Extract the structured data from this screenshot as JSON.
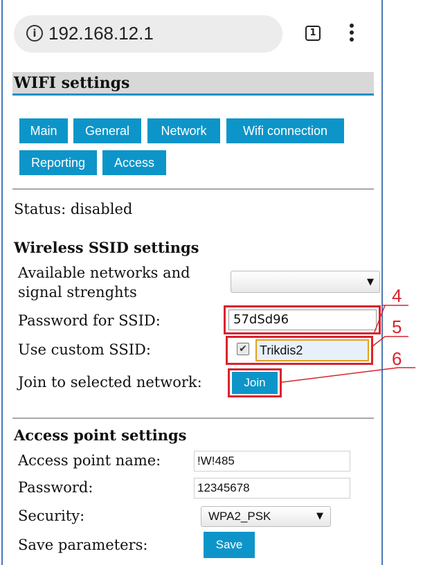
{
  "browser": {
    "url": "192.168.12.1",
    "info_icon": "i",
    "tab_count": "1"
  },
  "page": {
    "title": "WIFI settings",
    "tabs": [
      {
        "label": "Main"
      },
      {
        "label": "General"
      },
      {
        "label": "Network"
      },
      {
        "label": "Wifi connection"
      },
      {
        "label": "Reporting"
      },
      {
        "label": "Access"
      }
    ],
    "status": "Status: disabled"
  },
  "wireless": {
    "heading": "Wireless SSID settings",
    "available_label_line1": "Available networks and",
    "available_label_line2": "signal strenghts",
    "available_selected": "",
    "password_label": "Password for SSID:",
    "password_value": "57dSd96",
    "custom_ssid_label": "Use custom SSID:",
    "custom_ssid_checked": true,
    "custom_ssid_value": "Trikdis2",
    "join_label": "Join to selected network:",
    "join_button": "Join"
  },
  "callouts": [
    "4",
    "5",
    "6"
  ],
  "access_point": {
    "heading": "Access point settings",
    "name_label": "Access point name:",
    "name_value": "!W!485",
    "password_label": "Password:",
    "password_value": "12345678",
    "security_label": "Security:",
    "security_value": "WPA2_PSK",
    "save_label": "Save parameters:",
    "save_button": "Save"
  },
  "colors": {
    "accent": "#0d95c9",
    "highlight": "#d9232e",
    "frame": "#4a78b5"
  }
}
